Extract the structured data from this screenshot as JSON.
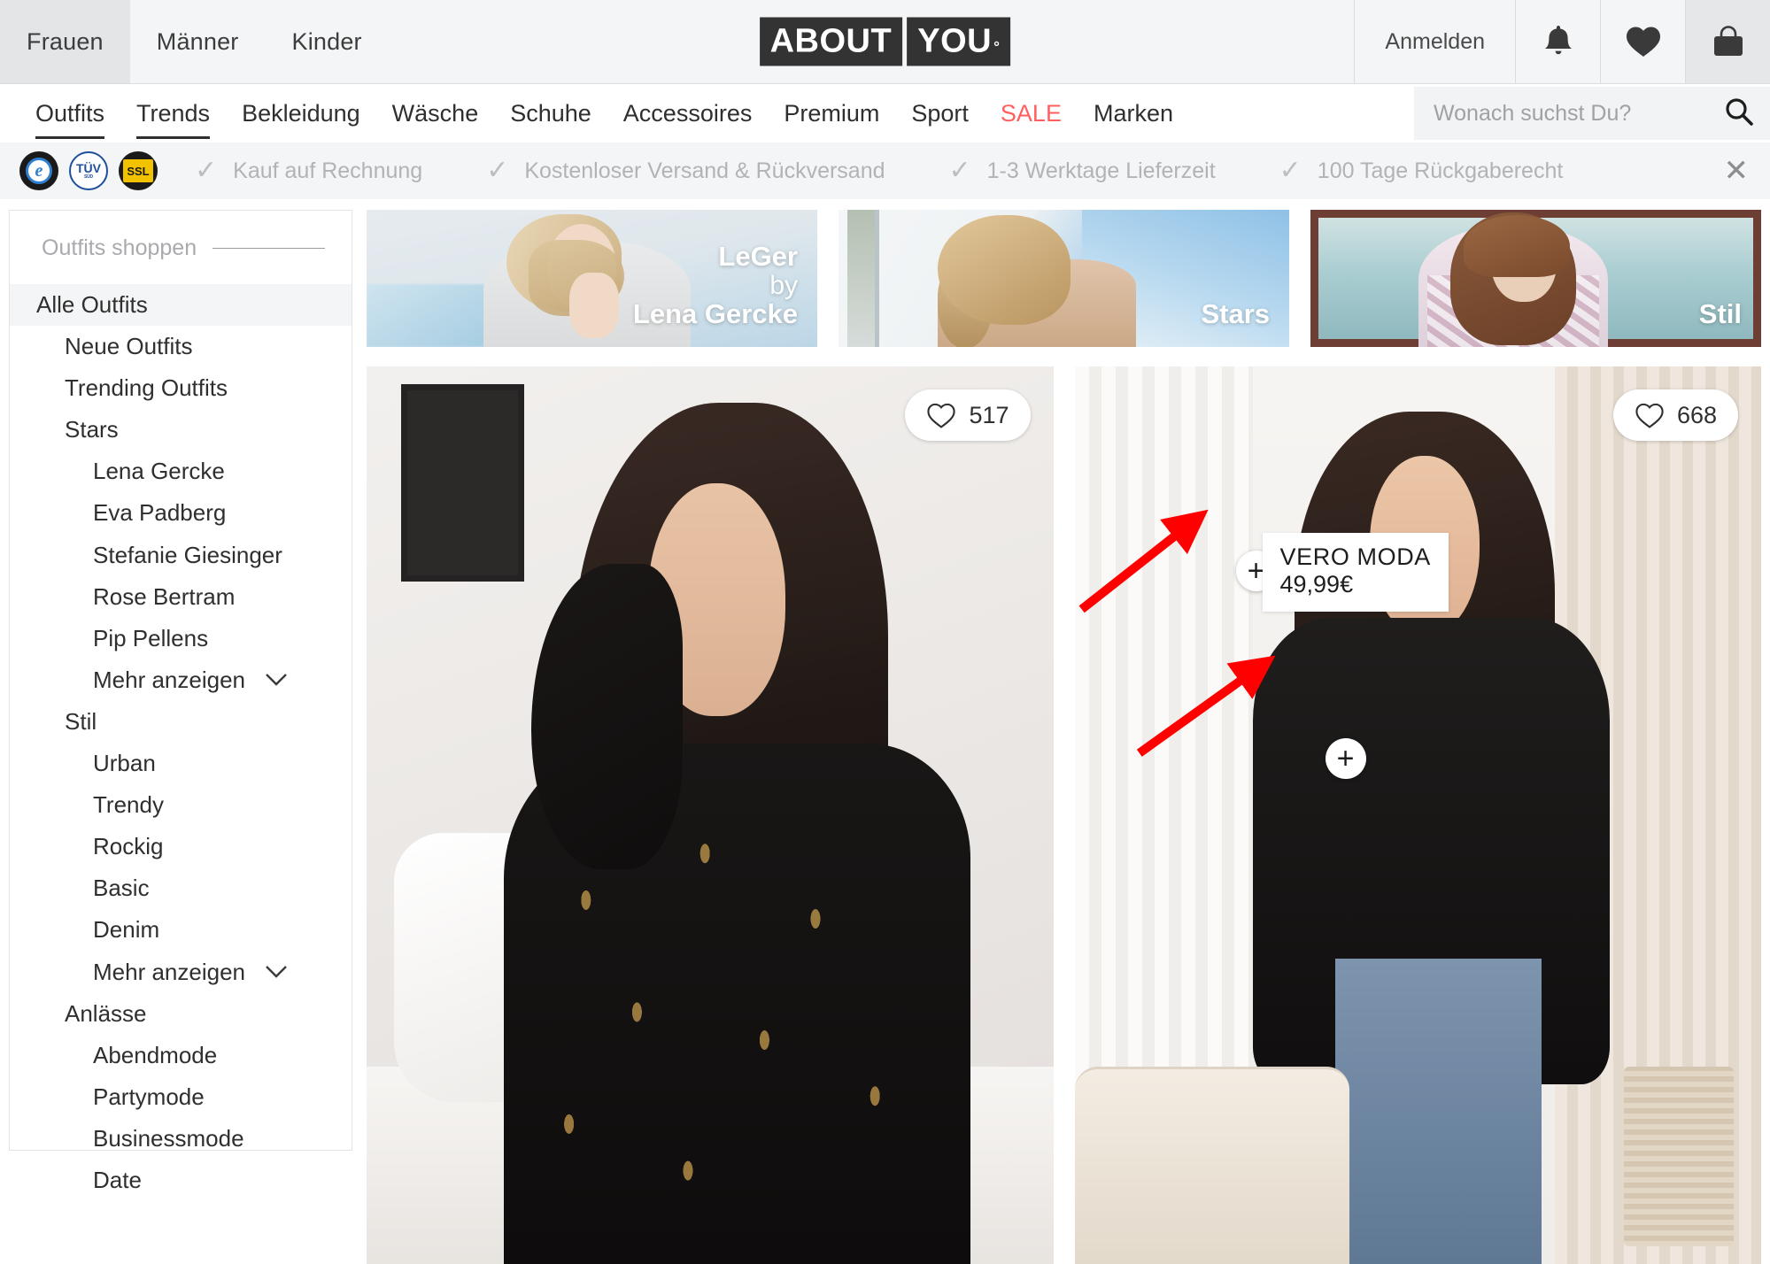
{
  "topbar": {
    "gender_tabs": [
      {
        "label": "Frauen",
        "active": true
      },
      {
        "label": "Männer",
        "active": false
      },
      {
        "label": "Kinder",
        "active": false
      }
    ],
    "logo": {
      "part1": "ABOUT",
      "part2": "YOU",
      "degree": "°"
    },
    "login_label": "Anmelden",
    "icons": [
      "bell-icon",
      "heart-icon",
      "shopping-bag-icon"
    ]
  },
  "mainnav": {
    "items": [
      {
        "label": "Outfits",
        "underlined": true,
        "sale": false
      },
      {
        "label": "Trends",
        "underlined": true,
        "sale": false
      },
      {
        "label": "Bekleidung",
        "underlined": false,
        "sale": false
      },
      {
        "label": "Wäsche",
        "underlined": false,
        "sale": false
      },
      {
        "label": "Schuhe",
        "underlined": false,
        "sale": false
      },
      {
        "label": "Accessoires",
        "underlined": false,
        "sale": false
      },
      {
        "label": "Premium",
        "underlined": false,
        "sale": false
      },
      {
        "label": "Sport",
        "underlined": false,
        "sale": false
      },
      {
        "label": "SALE",
        "underlined": false,
        "sale": true
      },
      {
        "label": "Marken",
        "underlined": false,
        "sale": false
      }
    ],
    "sale_color": "#ff5f5f",
    "search": {
      "value": "",
      "placeholder": "Wonach suchst Du?"
    }
  },
  "trustbar": {
    "badges": [
      {
        "name": "trusted-shops-badge",
        "text": "e"
      },
      {
        "name": "tuv-badge",
        "text": "TÜV",
        "sub": "SÜD"
      },
      {
        "name": "ssl-badge",
        "text": "SSL"
      }
    ],
    "items": [
      "Kauf auf Rechnung",
      "Kostenloser Versand & Rückversand",
      "1-3 Werktage Lieferzeit",
      "100 Tage Rückgaberecht"
    ],
    "check_glyph": "✓",
    "close_glyph": "✕"
  },
  "sidebar": {
    "title": "Outfits shoppen",
    "items": [
      {
        "label": "Alle Outfits",
        "level": 0,
        "selected": true,
        "chevron": false
      },
      {
        "label": "Neue Outfits",
        "level": 1,
        "selected": false,
        "chevron": false
      },
      {
        "label": "Trending Outfits",
        "level": 1,
        "selected": false,
        "chevron": false
      },
      {
        "label": "Stars",
        "level": 1,
        "selected": false,
        "chevron": false
      },
      {
        "label": "Lena Gercke",
        "level": 2,
        "selected": false,
        "chevron": false
      },
      {
        "label": "Eva Padberg",
        "level": 2,
        "selected": false,
        "chevron": false
      },
      {
        "label": "Stefanie Giesinger",
        "level": 2,
        "selected": false,
        "chevron": false
      },
      {
        "label": "Rose Bertram",
        "level": 2,
        "selected": false,
        "chevron": false
      },
      {
        "label": "Pip Pellens",
        "level": 2,
        "selected": false,
        "chevron": false
      },
      {
        "label": "Mehr anzeigen",
        "level": 2,
        "selected": false,
        "chevron": true
      },
      {
        "label": "Stil",
        "level": 1,
        "selected": false,
        "chevron": false
      },
      {
        "label": "Urban",
        "level": 2,
        "selected": false,
        "chevron": false
      },
      {
        "label": "Trendy",
        "level": 2,
        "selected": false,
        "chevron": false
      },
      {
        "label": "Rockig",
        "level": 2,
        "selected": false,
        "chevron": false
      },
      {
        "label": "Basic",
        "level": 2,
        "selected": false,
        "chevron": false
      },
      {
        "label": "Denim",
        "level": 2,
        "selected": false,
        "chevron": false
      },
      {
        "label": "Mehr anzeigen",
        "level": 2,
        "selected": false,
        "chevron": true
      },
      {
        "label": "Anlässe",
        "level": 1,
        "selected": false,
        "chevron": false
      },
      {
        "label": "Abendmode",
        "level": 2,
        "selected": false,
        "chevron": false
      },
      {
        "label": "Partymode",
        "level": 2,
        "selected": false,
        "chevron": false
      },
      {
        "label": "Businessmode",
        "level": 2,
        "selected": false,
        "chevron": false
      },
      {
        "label": "Date",
        "level": 2,
        "selected": false,
        "chevron": false
      }
    ]
  },
  "banners": [
    {
      "name": "banner-leger",
      "line1": "LeGer",
      "line2": "by",
      "line3": "Lena Gercke"
    },
    {
      "name": "banner-stars",
      "line1": "",
      "line2": "",
      "line3": "Stars"
    },
    {
      "name": "banner-stil",
      "line1": "",
      "line2": "",
      "line3": "Stil"
    }
  ],
  "cards": [
    {
      "name": "outfit-card-1",
      "likes": "517",
      "heart_glyph": "♥",
      "hotspots": []
    },
    {
      "name": "outfit-card-2",
      "likes": "668",
      "heart_glyph": "♥",
      "hotspots": [
        {
          "plus": "+",
          "brand": "VERO MODA",
          "price": "49,99€"
        },
        {
          "plus": "+",
          "brand": "",
          "price": ""
        }
      ]
    }
  ],
  "annotations": {
    "arrow_color": "#ff0000",
    "arrow_count": 2
  }
}
